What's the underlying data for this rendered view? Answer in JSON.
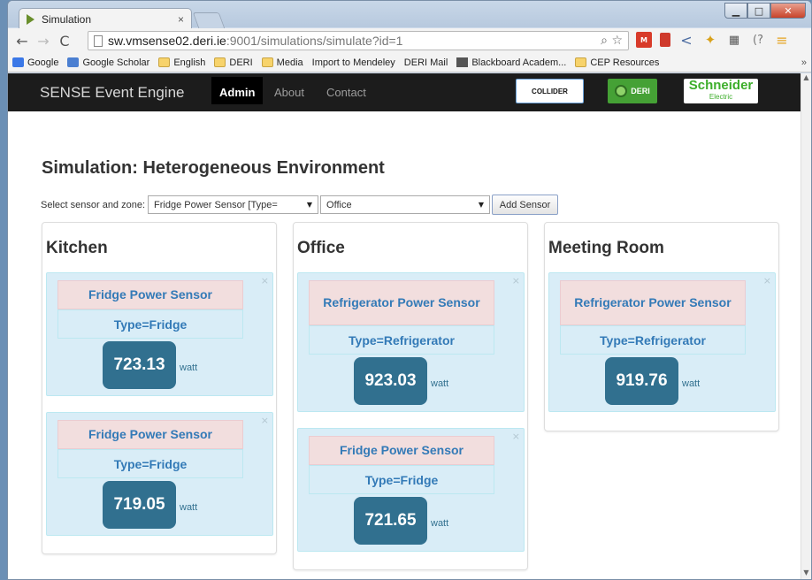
{
  "browser": {
    "tab_title": "Simulation",
    "tab_close": "×",
    "url_host": "sw.vmsense02.deri.ie",
    "url_path": ":9001/simulations/simulate?id=1",
    "back": "←",
    "forward": "→",
    "reload": "C",
    "bookmarks": [
      {
        "label": "Google",
        "icon": "google-icon"
      },
      {
        "label": "Google Scholar",
        "icon": "scholar-icon"
      },
      {
        "label": "English",
        "icon": "folder-icon"
      },
      {
        "label": "DERI",
        "icon": "folder-icon"
      },
      {
        "label": "Media",
        "icon": "folder-icon"
      },
      {
        "label": "Import to Mendeley",
        "icon": "page-icon"
      },
      {
        "label": "DERI Mail",
        "icon": "page-icon"
      },
      {
        "label": "Blackboard Academ...",
        "icon": "blackboard-icon"
      },
      {
        "label": "CEP Resources",
        "icon": "folder-icon"
      }
    ],
    "bookmarks_more": "»"
  },
  "navbar": {
    "brand": "SENSE Event Engine",
    "links": [
      "Admin",
      "About",
      "Contact"
    ],
    "active": "Admin",
    "logos": {
      "collider": "COLLIDER",
      "deri": "DERI",
      "schneider": "Schneider",
      "schneider_sub": "Electric"
    }
  },
  "page": {
    "title": "Simulation: Heterogeneous Environment",
    "select_label": "Select sensor and zone:",
    "sensor_select": "Fridge Power Sensor [Type=",
    "zone_select": "Office",
    "add_button": "Add Sensor"
  },
  "zones": [
    {
      "name": "Kitchen",
      "sensors": [
        {
          "name": "Fridge Power Sensor",
          "type": "Type=Fridge",
          "value": "723.13",
          "unit": "watt"
        },
        {
          "name": "Fridge Power Sensor",
          "type": "Type=Fridge",
          "value": "719.05",
          "unit": "watt"
        }
      ]
    },
    {
      "name": "Office",
      "sensors": [
        {
          "name": "Refrigerator Power Sensor",
          "type": "Type=Refrigerator",
          "value": "923.03",
          "unit": "watt"
        },
        {
          "name": "Fridge Power Sensor",
          "type": "Type=Fridge",
          "value": "721.65",
          "unit": "watt"
        }
      ]
    },
    {
      "name": "Meeting Room",
      "sensors": [
        {
          "name": "Refrigerator Power Sensor",
          "type": "Type=Refrigerator",
          "value": "919.76",
          "unit": "watt"
        }
      ]
    }
  ],
  "close_glyph": "×"
}
